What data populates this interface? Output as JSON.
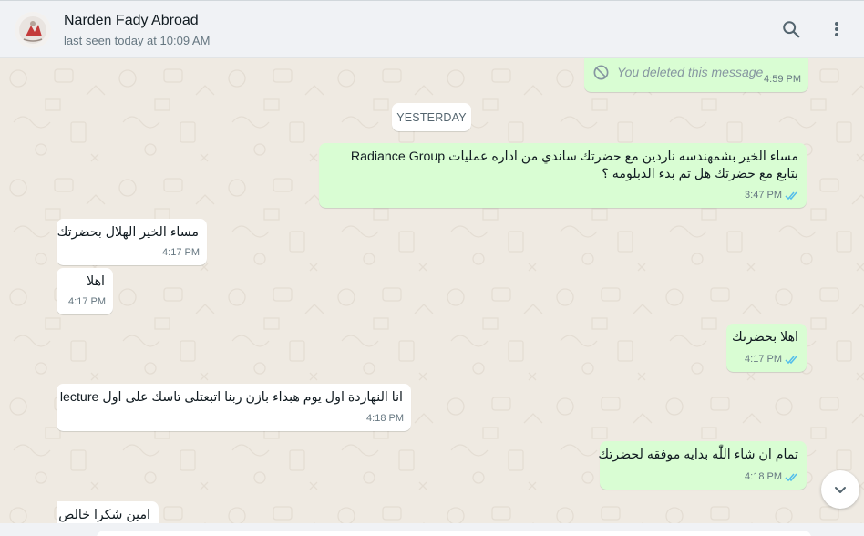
{
  "header": {
    "contact_name": "Narden Fady Abroad",
    "last_seen": "last seen today at 10:09 AM",
    "icons": {
      "search": "search-icon",
      "menu": "kebab-menu-icon"
    }
  },
  "chat": {
    "date_separator": "YESTERDAY",
    "messages": [
      {
        "direction": "out",
        "deleted": true,
        "text": "You deleted this message",
        "time": "4:59 PM"
      },
      {
        "direction": "out",
        "text_line1": "مساء الخير بشمهندسه ناردين مع حضرتك ساندي من اداره عمليات Radiance Group",
        "text_line2": "بتابع مع حضرتك هل تم بدء الدبلومه ؟",
        "time": "3:47 PM",
        "status": "read"
      },
      {
        "direction": "in",
        "text": "مساء الخير الهلال بحضرتك",
        "time": "4:17 PM"
      },
      {
        "direction": "in",
        "text": "اهلا",
        "time": "4:17 PM"
      },
      {
        "direction": "out",
        "text": "اهلا بحضرتك",
        "time": "4:17 PM",
        "status": "read"
      },
      {
        "direction": "in",
        "text": "انا النهاردة اول يوم هبداء بازن ربنا اتبعتلى تاسك على اول lecture",
        "time": "4:18 PM"
      },
      {
        "direction": "out",
        "text": "تمام ان شاء اللّٰه بدايه موفقه لحضرتك",
        "time": "4:18 PM",
        "status": "read"
      },
      {
        "direction": "in",
        "text": "امين شكرا خالص",
        "time": ""
      }
    ]
  },
  "colors": {
    "outgoing_bubble": "#d9fdd3",
    "incoming_bubble": "#ffffff",
    "chat_background": "#efeae2",
    "read_ticks": "#53bdeb"
  }
}
